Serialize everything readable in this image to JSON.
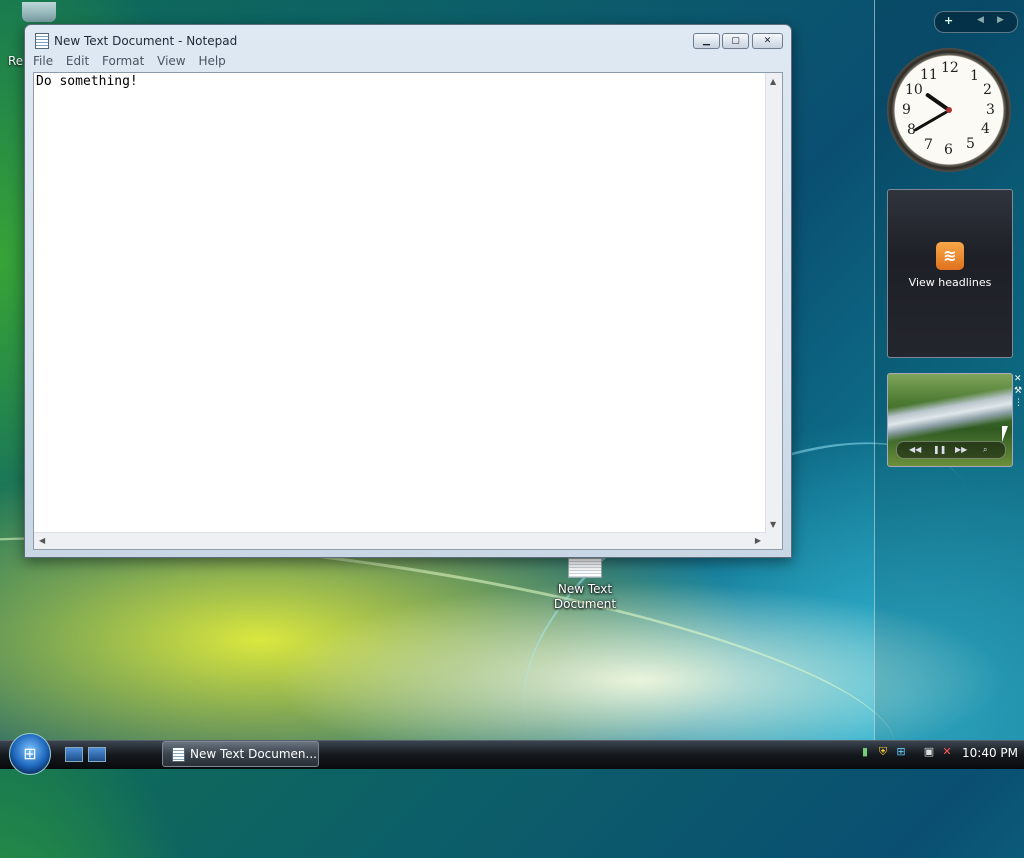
{
  "desktop": {
    "recycle_bin_label": "Re",
    "file_icon_label_line1": "New Text",
    "file_icon_label_line2": "Document"
  },
  "notepad": {
    "title": "New Text Document - Notepad",
    "menu": [
      "File",
      "Edit",
      "Format",
      "View",
      "Help"
    ],
    "content": "Do something!"
  },
  "sidebar": {
    "add_symbol": "+",
    "clock_numerals": [
      "12",
      "1",
      "2",
      "3",
      "4",
      "5",
      "6",
      "7",
      "8",
      "9",
      "10",
      "11"
    ],
    "feed_label": "View headlines"
  },
  "taskbar": {
    "task_label": "New Text Documen...",
    "time": "10:40 PM"
  },
  "icons": {
    "recycle": "recycle-bin-icon",
    "rss": "rss-icon",
    "start": "windows-start-icon"
  }
}
